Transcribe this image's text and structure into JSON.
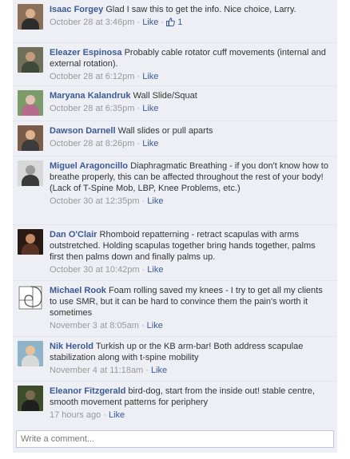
{
  "comments": [
    {
      "author": "Isaac Forgey",
      "text": "Glad I saw this to get the info. Nice choice, Larry.",
      "time": "October 28 at 3:46pm",
      "like": "Like",
      "likes": "1",
      "avatar_colors": [
        "#8c6f57",
        "#d7b08c",
        "#2c2c2c"
      ]
    },
    {
      "author": "Eleazer Espinosa",
      "text": "Probably cable rotator cuff movements (internal and external rotation).",
      "time": "October 28 at 6:12pm",
      "like": "Like",
      "avatar_colors": [
        "#6f6f5a",
        "#c49a7d",
        "#3f4a3a"
      ]
    },
    {
      "author": "Maryana Kalandruk",
      "text": "Wall Slide/Squat",
      "time": "October 28 at 6:35pm",
      "like": "Like",
      "avatar_colors": [
        "#7d9a6a",
        "#e1c1b2",
        "#b66b8a"
      ]
    },
    {
      "author": "Dawson Darnell",
      "text": "Wall slides or pull aparts",
      "time": "October 28 at 8:26pm",
      "like": "Like",
      "avatar_colors": [
        "#7a5d48",
        "#e0b38f",
        "#3b3b3b"
      ]
    },
    {
      "author": "Miguel Aragoncillo",
      "text": "Diaphragmatic Breathing - if you don't know how to breathe properly, this can be affected throughout the rest of your body! (Lack of T-Spine Mob, LBP, Knee Problems, etc.)",
      "time": "October 30 at 12:35pm",
      "like": "Like",
      "avatar_colors": [
        "#d8d8d8",
        "#9a9a9a",
        "#3a3a3a"
      ]
    },
    {
      "author": "Dan O'Clair",
      "text": "Rhomboid repatterning - retract scapulas with arms outstretched. Holding scapulas together bring hands together, palms first then palms down and finally palms up.",
      "time": "October 30 at 10:42pm",
      "like": "Like",
      "avatar_colors": [
        "#2a1a14",
        "#c58a63",
        "#5a3324"
      ]
    },
    {
      "author": "Michael Rook",
      "text": "Foam rolling saved my knees - I try to get all my clients to use SMR, but it can be hard to convince them the pain's worth it sometimes",
      "time": "November 3 at 8:05am",
      "like": "Like",
      "avatar_colors": [
        "#f4f4f4",
        "#555555",
        "#999999"
      ]
    },
    {
      "author": "Nik Herold",
      "text": "Turkish up or the KB arm-bar! Both address scapulae stabilization along with t-spine mobility",
      "time": "November 4 at 11:18am",
      "like": "Like",
      "avatar_colors": [
        "#8fb3c9",
        "#e8c09a",
        "#d9d9d9"
      ]
    },
    {
      "author": "Eleanor Fitzgerald",
      "text": "bird-dog, start from the inside out! stable centre, smooth movement patterns for periphery",
      "time": "17 hours ago",
      "like": "Like",
      "avatar_colors": [
        "#3d4d2b",
        "#7a6a4f",
        "#1f1f1f"
      ]
    }
  ],
  "write_placeholder": "Write a comment..."
}
